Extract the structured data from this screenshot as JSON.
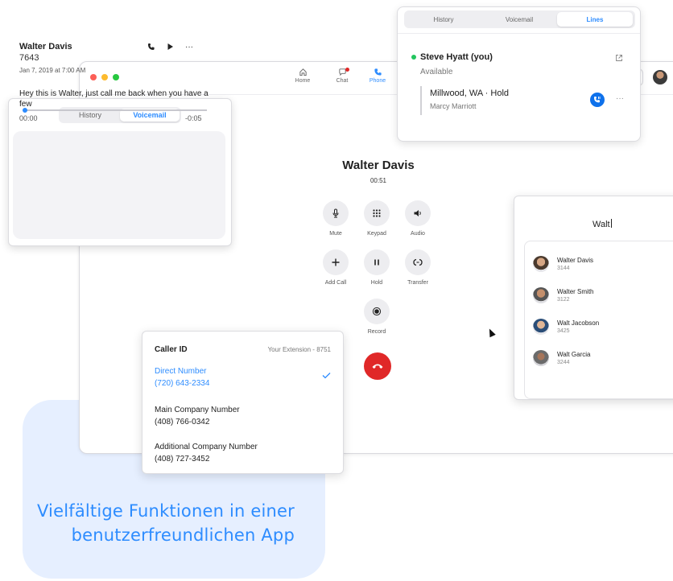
{
  "promo": {
    "headline": "Vielfältige Funktionen in einer benutzerfreundlichen App"
  },
  "colors": {
    "accent": "#2d8cff",
    "end_call": "#e02828",
    "presence": "#22c55e"
  },
  "main_window": {
    "nav": [
      {
        "label": "Home",
        "icon": "home-icon"
      },
      {
        "label": "Chat",
        "icon": "chat-icon"
      },
      {
        "label": "Phone",
        "icon": "phone-icon",
        "active": true
      }
    ]
  },
  "call": {
    "name": "Walter Davis",
    "duration": "00:51",
    "controls": {
      "mute": "Mute",
      "keypad": "Keypad",
      "audio": "Audio",
      "add_call": "Add Call",
      "hold": "Hold",
      "transfer": "Transfer",
      "record": "Record"
    }
  },
  "lines_panel": {
    "tabs": [
      "History",
      "Voicemail",
      "Lines"
    ],
    "active_tab": "Lines",
    "me": {
      "name": "Steve Hyatt (you)",
      "status": "Available"
    },
    "held_call": {
      "title": "Millwood, WA · Hold",
      "subtitle": "Marcy Marriott"
    },
    "more": "···"
  },
  "voicemail_panel": {
    "tabs": [
      "History",
      "Voicemail"
    ],
    "active_tab": "Voicemail",
    "item": {
      "name": "Walter Davis",
      "extension": "7643",
      "date": "Jan 7, 2019 at 7:00 AM",
      "transcript": "Hey this is Walter, just call me back when you have a few",
      "time_elapsed": "00:00",
      "time_remaining": "-0:05",
      "progress": 0.0,
      "more": "···"
    }
  },
  "caller_id": {
    "title": "Caller ID",
    "extension_label": "Your Extension - 8751",
    "options": [
      {
        "label": "Direct Number",
        "number": "(720) 643-2334",
        "selected": true
      },
      {
        "label": "Main Company Number",
        "number": "(408) 766-0342",
        "selected": false
      },
      {
        "label": "Additional Company Number",
        "number": "(408) 727-3452",
        "selected": false
      }
    ]
  },
  "contact_search": {
    "query": "Walt",
    "results": [
      {
        "name": "Walter Davis",
        "ext": "3144"
      },
      {
        "name": "Walter Smith",
        "ext": "3122"
      },
      {
        "name": "Walt Jacobson",
        "ext": "3425"
      },
      {
        "name": "Walt Garcia",
        "ext": "3244"
      }
    ]
  }
}
